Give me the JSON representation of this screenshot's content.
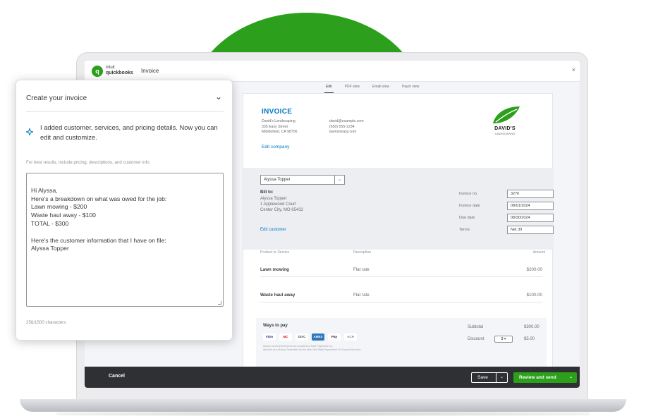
{
  "window": {
    "brand_top": "intuit",
    "brand_name": "quickbooks",
    "title": "Invoice",
    "close": "×"
  },
  "view_tabs": [
    "Edit",
    "PDF view",
    "Email view",
    "Payor view"
  ],
  "invoice": {
    "title": "INVOICE",
    "company_lines": [
      "David's Landscaping",
      "335 Easy Street",
      "Middlefield, CA 98756"
    ],
    "contact_lines": [
      "david@example.com",
      "(650) 555-1234",
      "lawnstreasy.com"
    ],
    "edit_company": "Edit company",
    "logo_name": "DAVID'S",
    "logo_sub": "LANDSCAPING",
    "customer_select": "Alyssa Topper",
    "bill_to_label": "Bill to:",
    "bill_lines": [
      "Alyssa Topper",
      "1 Applewood Court",
      "Center City, MO 65432"
    ],
    "edit_customer": "Edit customer",
    "meta": [
      {
        "label": "Invoice no.",
        "value": "3276"
      },
      {
        "label": "Invoice date",
        "value": "08/01/2024"
      },
      {
        "label": "Due date",
        "value": "08/30/2024"
      },
      {
        "label": "Terms",
        "value": "Net 30"
      }
    ],
    "line_headers": {
      "product": "Product or Service",
      "description": "Description",
      "amount": "Amount"
    },
    "lines": [
      {
        "product": "Lawn mowing",
        "description": "Flat rate",
        "amount": "$200.00"
      },
      {
        "product": "Waste haul away",
        "description": "Flat rate",
        "amount": "$100.00"
      }
    ],
    "ways_to_pay": "Ways to pay",
    "pay_methods": [
      "VISA",
      "MC",
      "DISC",
      "AMEX",
      "Pay",
      "ACH"
    ],
    "pay_fine_print": [
      "Money movement services are provided by Intuit Payments Inc.,",
      "licensed as a Money Transmitter by the New York State Department of Financial Services"
    ],
    "subtotal_label": "Subtotal",
    "subtotal_value": "$300.00",
    "discount_label": "Discount",
    "discount_pill": "$ ▾",
    "discount_value": "$5.00"
  },
  "footer": {
    "cancel": "Cancel",
    "save": "Save",
    "review_send": "Review and send"
  },
  "assistant": {
    "title": "Create your invoice",
    "message": "I added customer, services, and pricing details. Now you can edit and customize.",
    "hint": "For best results, include pricing, descriptions, and customer info.",
    "prompt": "Hi Alyssa,\nHere's a breakdown on what was owed for the job:\nLawn mowing - $200\nWaste haul away - $100\nTOTAL - $300\n\nHere's the customer information that I have on file:\nAlyssa Topper",
    "char_count": "256/1500 characters"
  },
  "colors": {
    "brand_green": "#2ca01c",
    "link_blue": "#0077c5",
    "footer_dark": "#2f3034"
  }
}
